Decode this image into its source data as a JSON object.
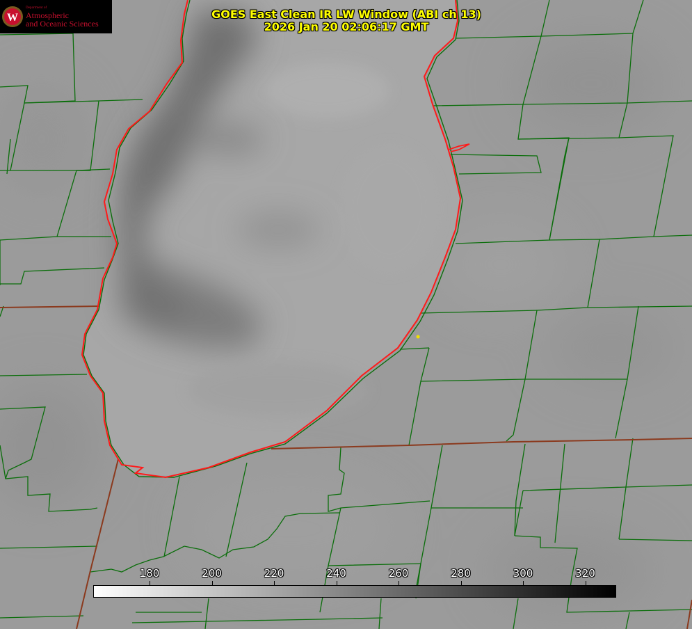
{
  "header": {
    "title_line1": "GOES East Clean IR LW Window (ABI ch 13)",
    "title_line2": "2026 Jan 20 02:06:17 GMT"
  },
  "logo": {
    "dept": "Department of",
    "line1": "Atmospheric",
    "line2": "and Oceanic Sciences",
    "seal_letter": "W"
  },
  "colorbar": {
    "labels": [
      "180",
      "200",
      "220",
      "240",
      "260",
      "280",
      "300",
      "320"
    ],
    "gradient_start": "#ffffff",
    "gradient_end": "#000000"
  },
  "map": {
    "lake_outline_color": "#ff1a1a",
    "boundary_color": "#0a6e0a",
    "state_line_color": "#8b3a1e",
    "marker_color": "#f0e000",
    "land_color": "#9a9a9a",
    "cloud_color": "#6c6c6c"
  }
}
